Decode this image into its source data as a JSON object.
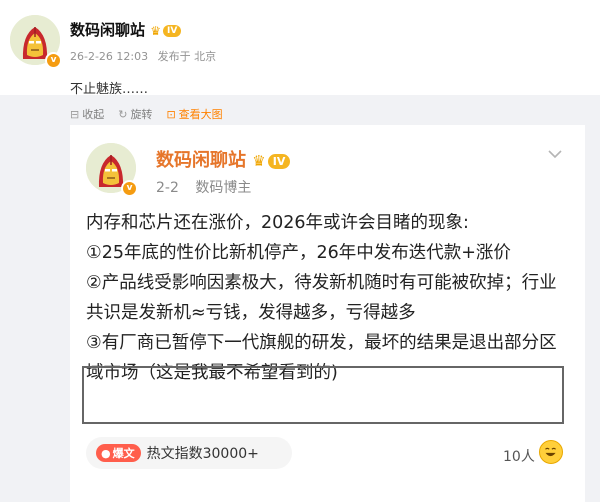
{
  "post": {
    "author": "数码闲聊站",
    "level": "IV",
    "verified_mark": "v",
    "timestamp": "26-2-26 12:03",
    "source": "发布于 北京",
    "text": "不止魅族……"
  },
  "actions": [
    {
      "label": "收起",
      "icon": "collapse-icon"
    },
    {
      "label": "旋转",
      "icon": "rotate-icon"
    },
    {
      "label": "查看大图",
      "icon": "view-large-image-icon"
    }
  ],
  "card": {
    "author": "数码闲聊站",
    "level": "IV",
    "date": "2-2",
    "role": "数码博主",
    "paragraphs": [
      "内存和芯片还在涨价，2026年或许会目睹的现象:",
      "①25年底的性价比新机停产，26年中发布迭代款+涨价",
      "②产品线受影响因素极大，待发新机随时有可能被砍掉；行业共识是发新机≈亏钱，发得越多，亏得越多",
      "③有厂商已暂停下一代旗舰的研发，最坏的结果是退出部分区域市场（这是我最不希望看到的)"
    ],
    "hot_badge": "爆文",
    "hot_text": "热文指数30000+",
    "likes": "10人"
  },
  "colors": {
    "accent_orange": "#ff8200",
    "author_orange": "#e6762b",
    "level_gold": "#f5b521",
    "hot_red": "#ff5e4c",
    "page_gray": "#f1f2f5"
  }
}
